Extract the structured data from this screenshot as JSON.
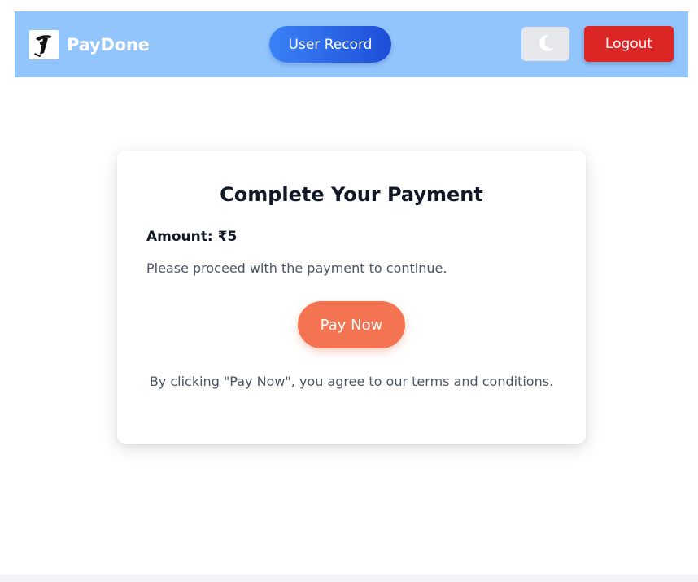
{
  "header": {
    "brand_name": "PayDone",
    "user_record_label": "User Record",
    "logout_label": "Logout",
    "theme_toggle_icon": "moon-icon",
    "logo_icon": "brand-logo-icon",
    "background_color": "#93c5fd"
  },
  "payment": {
    "title": "Complete Your Payment",
    "amount_label": "Amount:",
    "amount_value": "₹5",
    "instructions": "Please proceed with the payment to continue.",
    "pay_button_label": "Pay Now",
    "terms_text": "By clicking \"Pay Now\", you agree to our terms and conditions."
  },
  "colors": {
    "pay_button": "#f47452",
    "logout_button": "#dc2626",
    "user_record_gradient": [
      "#3b82f6",
      "#1d4ed8"
    ],
    "theme_toggle_bg": "#e5e7eb"
  }
}
